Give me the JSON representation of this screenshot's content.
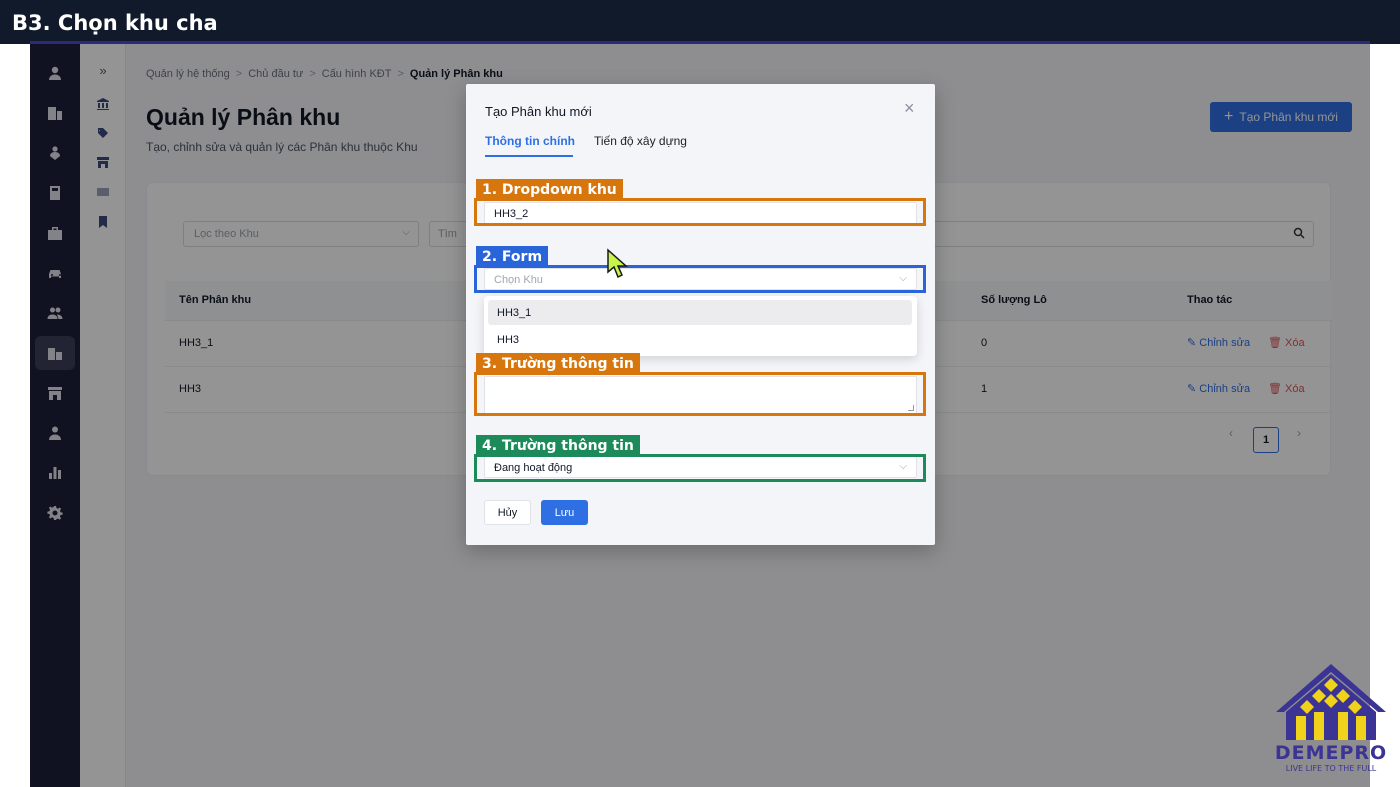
{
  "banner": {
    "title": "B3. Chọn khu cha"
  },
  "sidebar": {
    "icons": [
      "user-icon",
      "building-icon",
      "person-pin-icon",
      "calculator-icon",
      "briefcase-icon",
      "car-icon",
      "users-icon",
      "apartment-icon",
      "store-icon",
      "person-icon",
      "chart-icon",
      "gear-icon"
    ],
    "active_index": 7
  },
  "subnav": {
    "expand": "»",
    "icons": [
      "bank-icon",
      "tag-icon",
      "storefront-icon",
      "card-icon",
      "bookmark-icon"
    ]
  },
  "breadcrumb": {
    "items": [
      "Quản lý hệ thống",
      "Chủ đầu tư",
      "Cấu hình KĐT"
    ],
    "current": "Quản lý Phân khu",
    "separator": ">"
  },
  "page": {
    "title": "Quản lý Phân khu",
    "description": "Tạo, chỉnh sửa và quản lý các Phân khu thuộc Khu",
    "create_button": "Tạo Phân khu mới"
  },
  "filters": {
    "khu_placeholder": "Lọc theo Khu",
    "search_placeholder": "Tìm"
  },
  "table": {
    "headers": [
      "Tên Phân khu",
      "Số lượng Lô",
      "Thao tác"
    ],
    "rows": [
      {
        "name": "HH3_1",
        "count": "0",
        "edit": "Chỉnh sửa",
        "delete": "Xóa"
      },
      {
        "name": "HH3",
        "count": "1",
        "edit": "Chỉnh sửa",
        "delete": "Xóa"
      }
    ]
  },
  "pagination": {
    "prev": "‹",
    "current": "1",
    "next": "›"
  },
  "modal": {
    "title": "Tạo Phân khu mới",
    "close": "×",
    "tabs": [
      "Thông tin chính",
      "Tiến độ xây dựng"
    ],
    "name_value": "HH3_2",
    "khu_placeholder": "Chọn Khu",
    "dropdown_options": [
      "HH3_1",
      "HH3"
    ],
    "status_value": "Đang hoạt động",
    "cancel": "Hủy",
    "save": "Lưu"
  },
  "annotations": [
    {
      "label": "1. Dropdown khu",
      "color": "#d8760e"
    },
    {
      "label": "2. Form",
      "color": "#2965d8"
    },
    {
      "label": "3. Trường thông tin",
      "color": "#d8760e"
    },
    {
      "label": "4. Trường thông tin",
      "color": "#1d8a5a"
    }
  ],
  "logo": {
    "name": "DEMEPRO",
    "tagline": "LIVE LIFE TO THE FULL"
  }
}
